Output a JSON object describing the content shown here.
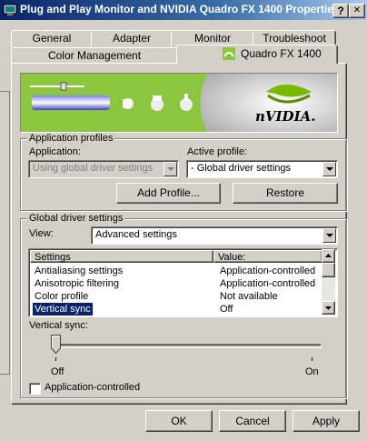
{
  "window": {
    "title": "Plug and Play Monitor and NVIDIA Quadro FX 1400 Properties",
    "help_btn": "?",
    "close_btn": "✕"
  },
  "tabs_row1": [
    "General",
    "Adapter",
    "Monitor",
    "Troubleshoot"
  ],
  "tabs_row2": [
    "Color Management",
    "Quadro FX 1400"
  ],
  "banner": {
    "logo_text": "nVIDIA.",
    "brand_color": "#8cc63f"
  },
  "app_profiles": {
    "group_title": "Application profiles",
    "application_label": "Application:",
    "application_value": "Using global driver settings",
    "active_profile_label": "Active profile:",
    "active_profile_value": "- Global driver settings",
    "add_profile_btn": "Add Profile...",
    "restore_btn": "Restore"
  },
  "global": {
    "group_title": "Global driver settings",
    "view_label": "View:",
    "view_value": "Advanced settings",
    "columns": [
      "Settings",
      "Value:"
    ],
    "rows": [
      {
        "setting": "Antialiasing settings",
        "value": "Application-controlled"
      },
      {
        "setting": "Anisotropic filtering",
        "value": "Application-controlled"
      },
      {
        "setting": "Color profile",
        "value": "Not available"
      },
      {
        "setting": "Vertical sync",
        "value": "Off"
      }
    ],
    "vsync_label": "Vertical sync:",
    "slider_min": "Off",
    "slider_max": "On",
    "checkbox_label": "Application-controlled"
  },
  "footer": {
    "ok": "OK",
    "cancel": "Cancel",
    "apply": "Apply"
  }
}
